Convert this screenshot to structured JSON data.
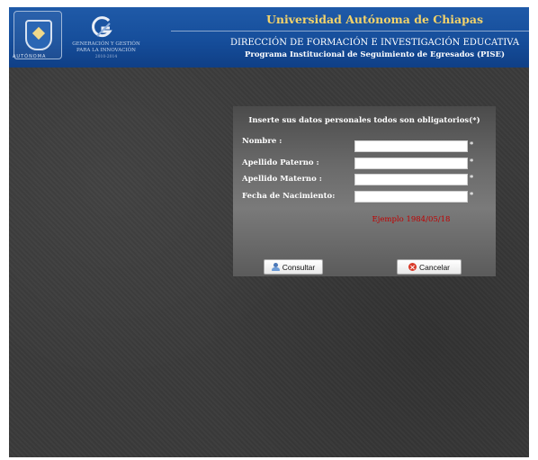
{
  "header": {
    "institution": "Universidad Autónoma de Chiapas",
    "direction": "DIRECCIÓN DE FORMACIÓN E INVESTIGACIÓN EDUCATIVA",
    "program": "Programa Institucional de Seguimiento de Egresados (PISE)",
    "seal_motto": "AUTÓNOMA",
    "tagline_line1": "GENERACIÓN Y GESTIÓN",
    "tagline_line2": "PARA LA INNOVACIÓN",
    "tagline_years": "2010-2014"
  },
  "form": {
    "instruction": "Inserte sus datos personales todos son obligatorios(*)",
    "fields": [
      {
        "label": "Nombre :",
        "value": "",
        "required_mark": "*"
      },
      {
        "label": "Apellido Paterno :",
        "value": "",
        "required_mark": "*"
      },
      {
        "label": "Apellido Materno :",
        "value": "",
        "required_mark": "*"
      },
      {
        "label": "Fecha de Nacimiento:",
        "value": "",
        "required_mark": "*"
      }
    ],
    "example": "Ejemplo 1984/05/18",
    "consult_label": "Consultar",
    "cancel_label": "Cancelar"
  },
  "colors": {
    "header_blue": "#164e9b",
    "title_gold": "#f3d36a",
    "example_red": "#c00000",
    "page_background": "#3a3a3a"
  },
  "icons": {
    "consult": "user-icon",
    "cancel": "cancel-circle-icon"
  }
}
